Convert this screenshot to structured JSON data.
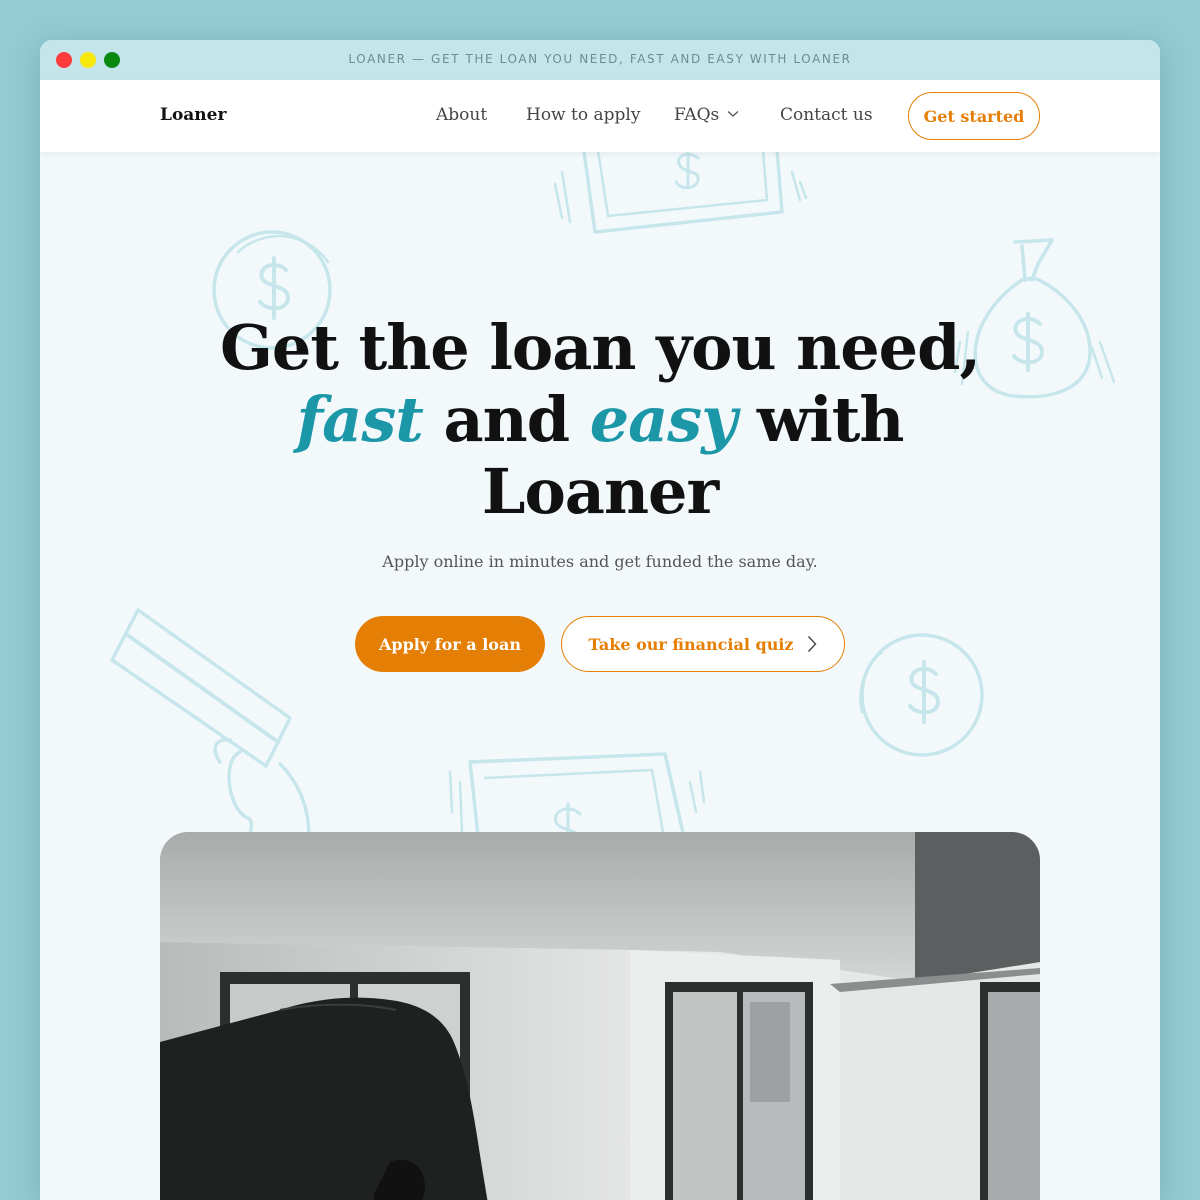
{
  "window": {
    "title": "LOANER — GET THE LOAN YOU NEED, FAST AND EASY WITH LOANER"
  },
  "nav": {
    "logo": "Loaner",
    "links": {
      "about": "About",
      "how_to_apply": "How to apply",
      "faqs": "FAQs",
      "contact": "Contact us"
    },
    "cta": "Get started"
  },
  "hero": {
    "headline_line1": "Get the loan you need,",
    "headline_fast": "fast",
    "headline_and": " and ",
    "headline_easy": "easy",
    "headline_with": " with",
    "headline_line3": "Loaner",
    "subtitle": "Apply online in minutes and get funded the same day.",
    "primary_button": "Apply for a loan",
    "secondary_button": "Take our financial quiz"
  },
  "colors": {
    "accent": "#1b97a8",
    "brand_orange": "#e57e04",
    "doodle": "#c6e6ec",
    "background": "#f3f9fb"
  },
  "icons": {
    "faqs_dropdown": "chevron-down-icon",
    "quiz_arrow": "chevron-right-icon"
  }
}
